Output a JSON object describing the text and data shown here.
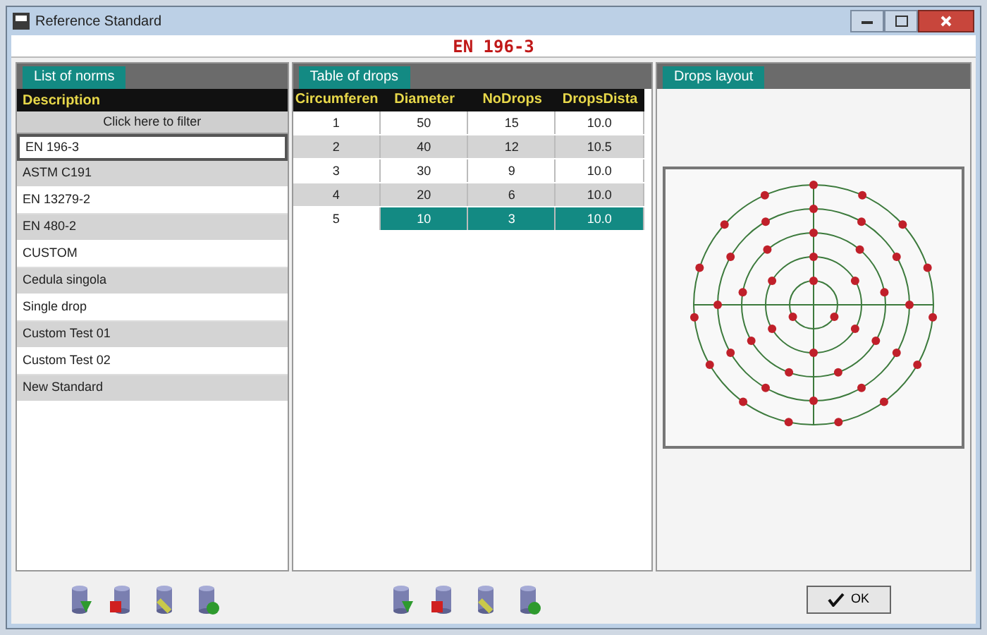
{
  "window": {
    "title": "Reference Standard"
  },
  "heading": "EN 196-3",
  "norms": {
    "tab": "List of norms",
    "column": "Description",
    "filter_button": "Click here to filter",
    "items": [
      {
        "label": "EN 196-3",
        "selected": true
      },
      {
        "label": "ASTM C191",
        "selected": false
      },
      {
        "label": "EN 13279-2",
        "selected": false
      },
      {
        "label": "EN 480-2",
        "selected": false
      },
      {
        "label": "CUSTOM",
        "selected": false
      },
      {
        "label": "Cedula singola",
        "selected": false
      },
      {
        "label": "Single drop",
        "selected": false
      },
      {
        "label": "Custom Test 01",
        "selected": false
      },
      {
        "label": "Custom Test 02",
        "selected": false
      },
      {
        "label": "New Standard",
        "selected": false
      }
    ]
  },
  "drops_table": {
    "tab": "Table of drops",
    "columns": [
      "Circumferen",
      "Diameter",
      "NoDrops",
      "DropsDista"
    ],
    "rows": [
      {
        "cells": [
          "1",
          "50",
          "15",
          "10.0"
        ],
        "selected": false
      },
      {
        "cells": [
          "2",
          "40",
          "12",
          "10.5"
        ],
        "selected": false
      },
      {
        "cells": [
          "3",
          "30",
          "9",
          "10.0"
        ],
        "selected": false
      },
      {
        "cells": [
          "4",
          "20",
          "6",
          "10.0"
        ],
        "selected": false
      },
      {
        "cells": [
          "5",
          "10",
          "3",
          "10.0"
        ],
        "selected": true
      }
    ]
  },
  "layout_panel": {
    "tab": "Drops layout"
  },
  "ok_button": "OK"
}
